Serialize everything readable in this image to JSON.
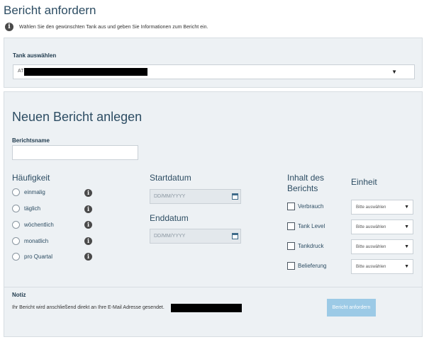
{
  "page": {
    "title": "Bericht anfordern",
    "info_text": "Wählen Sie den gewünschten Tank aus und geben Sie Informationen zum Bericht ein."
  },
  "tank": {
    "label": "Tank auswählen",
    "selected_value": "AT"
  },
  "report": {
    "title": "Neuen Bericht anlegen",
    "name_label": "Berichtsname",
    "name_value": "",
    "frequency_heading": "Häufigkeit",
    "frequency_options": [
      "einmalig",
      "täglich",
      "wöchentlich",
      "monatlich",
      "pro Quartal"
    ],
    "start_label": "Startdatum",
    "start_placeholder": "DD/MM/YYYY",
    "end_label": "Enddatum",
    "end_placeholder": "DD/MM/YYYY",
    "content_heading": "Inhalt des Berichts",
    "unit_heading": "Einheit",
    "content_options": [
      "Verbrauch",
      "Tank Level",
      "Tankdruck",
      "Belieferung"
    ],
    "unit_placeholder": "Bitte auswählen"
  },
  "note": {
    "label": "Notiz",
    "text": "Ihr Bericht wird anschließend direkt an Ihre E-Mail Adresse gesendet."
  },
  "submit_label": "Bericht anfordern",
  "colors": {
    "panel_bg": "#edf1f4",
    "heading": "#2d4d63",
    "button_bg": "#9ccae6"
  }
}
